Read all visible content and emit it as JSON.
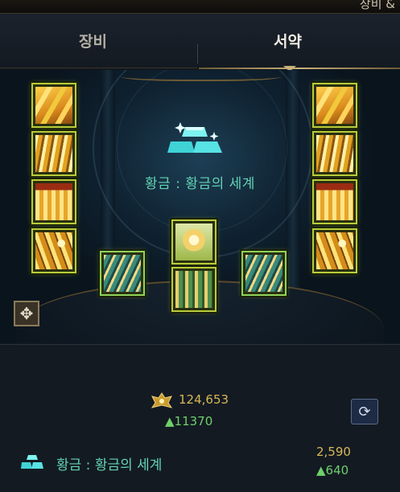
{
  "header": {
    "cut_title": "장비 &"
  },
  "tabs": [
    {
      "label": "장비",
      "active": false
    },
    {
      "label": "서약",
      "active": true
    }
  ],
  "set": {
    "name": "황금 : 황금의 세계"
  },
  "stats": {
    "combat_power": "124,653",
    "combat_power_delta": "▲11370",
    "set_value": "2,590",
    "set_value_delta": "▲640"
  },
  "icons": {
    "slots_left": [
      "feather-icon",
      "claw-icon",
      "wave-icon",
      "blade-icon"
    ],
    "slots_right": [
      "feather-icon",
      "claw-icon",
      "wave-icon",
      "blade-icon"
    ],
    "slots_bottom": [
      "teal-claw-icon",
      "crown-icon",
      "green-gold-icon",
      "teal-claw-icon"
    ]
  },
  "colors": {
    "accent_gold": "#d8b756",
    "teal_text": "#62d2b4",
    "increase_green": "#6fcf6a"
  }
}
